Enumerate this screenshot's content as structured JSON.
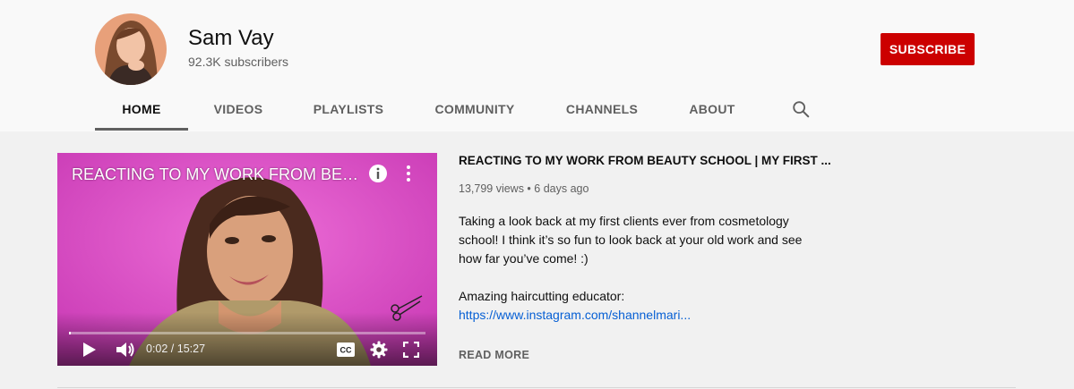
{
  "channel": {
    "name": "Sam Vay",
    "subscribers": "92.3K subscribers",
    "subscribe_label": "SUBSCRIBE"
  },
  "tabs": [
    {
      "label": "HOME",
      "active": true
    },
    {
      "label": "VIDEOS"
    },
    {
      "label": "PLAYLISTS"
    },
    {
      "label": "COMMUNITY"
    },
    {
      "label": "CHANNELS"
    },
    {
      "label": "ABOUT"
    }
  ],
  "icons": {
    "search": "search-icon",
    "info": "info-icon",
    "more": "more-vert-icon",
    "play": "play-icon",
    "volume": "volume-icon",
    "cc": "cc-icon",
    "settings": "gear-icon",
    "fullscreen": "fullscreen-icon"
  },
  "player": {
    "title": "REACTING TO MY WORK FROM BEAUTY SCHOOL | MY FIRST CLIENTS",
    "time": "0:02 / 15:27",
    "progress": 0.002
  },
  "video": {
    "heading": "REACTING TO MY WORK FROM BEAUTY SCHOOL | MY FIRST ...",
    "meta": "13,799 views • 6 days ago",
    "description_lines": [
      "Taking a look back at my first clients ever from cosmetology",
      "school! I think it’s so fun to look back at your old work and see",
      "how far you’ve come! :)",
      "",
      "Amazing haircutting educator:"
    ],
    "link": "https://www.instagram.com/shannelmari...",
    "read_more": "READ MORE"
  },
  "colors": {
    "subscribe": "#cc0000",
    "link": "#065fd4",
    "video_background": "#d94cc4"
  }
}
